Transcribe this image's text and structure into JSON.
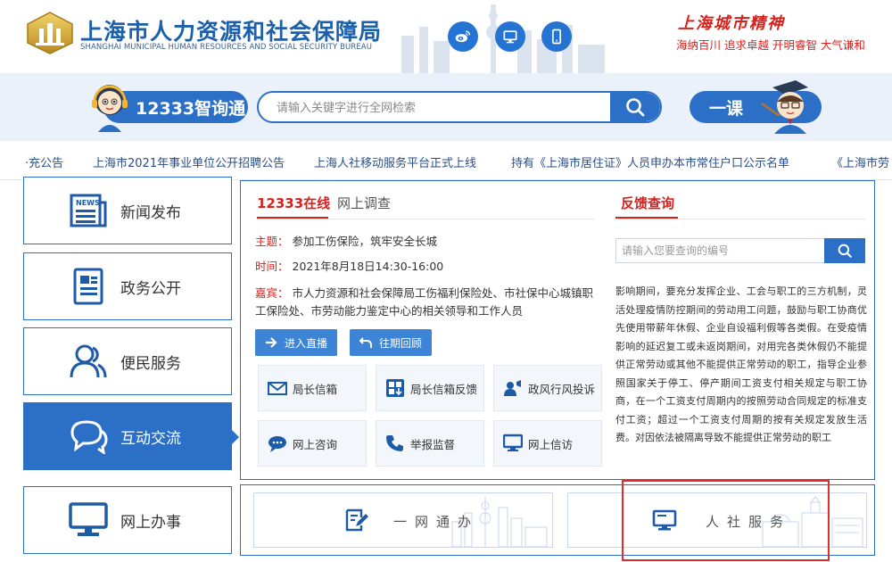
{
  "header": {
    "title": "上海市人力资源和社会保障局",
    "subtitle": "SHANGHAI MUNICIPAL HUMAN RESOURCES AND SOCIAL SECURITY BUREAU",
    "social_icons": [
      "weibo-icon",
      "desktop-icon",
      "mobile-icon"
    ],
    "spirit_title": "上海城市精神",
    "spirit_slogan": "海纳百川  追求卓越  开明睿智  大气谦和"
  },
  "search": {
    "hotline_label": "12333智询通",
    "placeholder": "请输入关键字进行全网检索",
    "course_label": "一课"
  },
  "ticker": {
    "items": [
      "·充公告",
      "上海市2021年事业单位公开招聘公告",
      "上海人社移动服务平台正式上线",
      "持有《上海市居住证》人员申办本市常住户口公示名单",
      "《上海市劳"
    ]
  },
  "nav": {
    "items": [
      {
        "label": "新闻发布",
        "icon": "newspaper-icon"
      },
      {
        "label": "政务公开",
        "icon": "document-icon"
      },
      {
        "label": "便民服务",
        "icon": "people-icon"
      },
      {
        "label": "互动交流",
        "icon": "chat-icon",
        "active": true
      },
      {
        "label": "网上办事",
        "icon": "monitor-icon"
      }
    ]
  },
  "panel": {
    "tab_active": "12333在线",
    "tab_inactive": "网上调查",
    "topic_key": "主题：",
    "topic_value": "参加工伤保险，筑牢安全长城",
    "time_key": "时间：",
    "time_value": "2021年8月18日14:30-16:00",
    "guest_key": "嘉宾：",
    "guest_value": "市人力资源和社会保障局工伤福利保险处、市社保中心城镇职工保险处、市劳动能力鉴定中心的相关领导和工作人员",
    "btn_live": "进入直播",
    "btn_review": "往期回顾",
    "services": [
      {
        "label": "局长信箱",
        "icon": "mail-icon"
      },
      {
        "label": "局长信箱反馈",
        "icon": "feedback-icon"
      },
      {
        "label": "政风行风投诉",
        "icon": "complaint-icon"
      },
      {
        "label": "网上咨询",
        "icon": "consult-icon"
      },
      {
        "label": "举报监督",
        "icon": "phone-icon"
      },
      {
        "label": "网上信访",
        "icon": "monitor-icon"
      }
    ]
  },
  "feedback": {
    "title": "反馈查询",
    "placeholder": "请输入您要查询的编号",
    "text": "影响期间，要充分发挥企业、工会与职工的三方机制，灵活处理疫情防控期间的劳动用工问题，鼓励与职工协商优先使用带薪年休假、企业自设福利假等各类假。在受疫情影响的延迟复工或未返岗期间，对用完各类休假仍不能提供正常劳动或其他不能提供正常劳动的职工，指导企业参照国家关于停工、停产期间工资支付相关规定与职工协商，在一个工资支付周期内的按照劳动合同规定的标准支付工资；超过一个工资支付周期的按有关规定发放生活费。对因依法被隔离导致不能提供正常劳动的职工"
  },
  "entries": {
    "one_network": "一网通办",
    "hr_service": "人社服务"
  },
  "colors": {
    "primary": "#2b6fc6",
    "accent_red": "#d8201c",
    "band_bg": "#eaf1fa",
    "highlight": "#e02d2d"
  }
}
